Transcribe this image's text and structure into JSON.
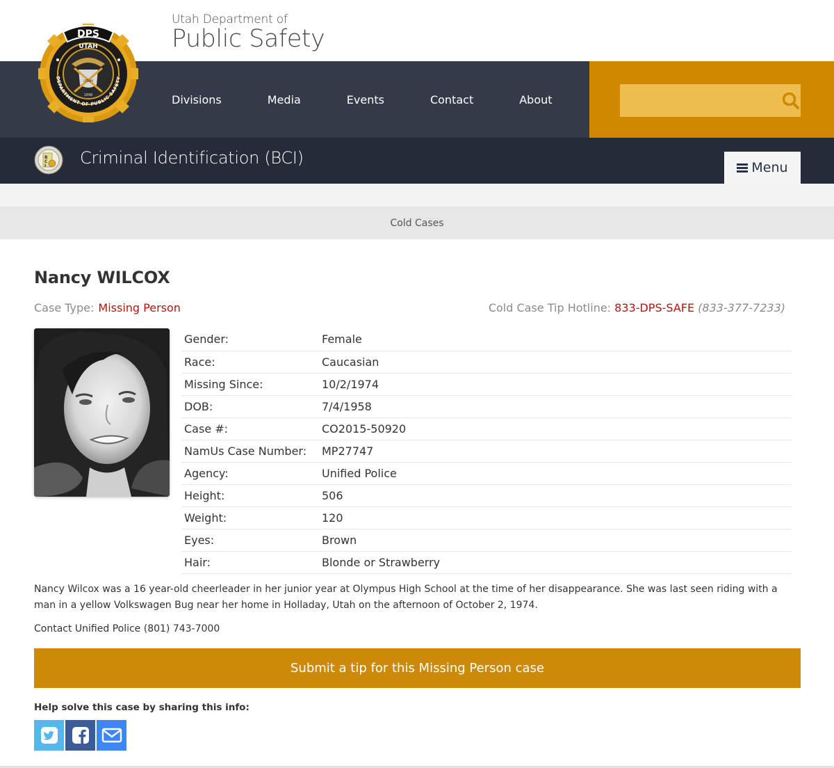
{
  "header": {
    "title_sub": "Utah Department of",
    "title_main": "Public Safety",
    "badge": {
      "top_text": "DPS",
      "state_text": "UTAH",
      "ring_text": "DEPARTMENT OF PUBLIC SAFETY",
      "year": "1896"
    },
    "nav": [
      {
        "label": "Divisions"
      },
      {
        "label": "Media"
      },
      {
        "label": "Events"
      },
      {
        "label": "Contact"
      },
      {
        "label": "About"
      }
    ],
    "search": {
      "placeholder": "",
      "value": "",
      "icon": "search-icon"
    }
  },
  "division": {
    "title": "Criminal Identification (BCI)",
    "seal_text": "BCI",
    "menu_label": "Menu",
    "menu_icon": "hamburger-icon"
  },
  "breadcrumb": {
    "label": "Cold Cases"
  },
  "case": {
    "name": "Nancy WILCOX",
    "case_type_label": "Case Type:",
    "case_type_value": "Missing Person",
    "hotline_label": "Cold Case Tip Hotline:",
    "hotline_value": "833-DPS-SAFE",
    "hotline_number": "(833-377-7233)",
    "details": [
      {
        "key": "Gender:",
        "value": "Female"
      },
      {
        "key": "Race:",
        "value": "Caucasian"
      },
      {
        "key": "Missing Since:",
        "value": "10/2/1974"
      },
      {
        "key": "DOB:",
        "value": "7/4/1958"
      },
      {
        "key": "Case #:",
        "value": "CO2015-50920"
      },
      {
        "key": "NamUs Case Number:",
        "value": "MP27747"
      },
      {
        "key": "Agency:",
        "value": "Unified Police"
      },
      {
        "key": "Height:",
        "value": "506"
      },
      {
        "key": "Weight:",
        "value": "120"
      },
      {
        "key": "Eyes:",
        "value": "Brown"
      },
      {
        "key": "Hair:",
        "value": "Blonde or Strawberry"
      }
    ],
    "description": "Nancy Wilcox was a 16 year-old cheerleader in her junior year at Olympus High School at the time of her disappearance.  She was last seen riding with a man in a yellow Volkswagen Bug near her home in Holladay, Utah on the afternoon of October 2, 1974.",
    "contact": "Contact Unified Police (801) 743-7000",
    "tip_button": "Submit a tip for this Missing Person case",
    "share_label": "Help solve this case by sharing this info:",
    "share": [
      {
        "name": "twitter",
        "icon": "twitter-icon",
        "color": "#55b8ec"
      },
      {
        "name": "facebook",
        "icon": "facebook-icon",
        "color": "#3b5b99"
      },
      {
        "name": "email",
        "icon": "email-icon",
        "color": "#3c86f5"
      }
    ]
  },
  "colors": {
    "nav_bg": "#343a48",
    "division_bg": "#252b38",
    "accent_orange": "#d08800",
    "search_field": "#eebd50",
    "link_red": "#b3140c",
    "tip_button": "#cc8a08"
  }
}
